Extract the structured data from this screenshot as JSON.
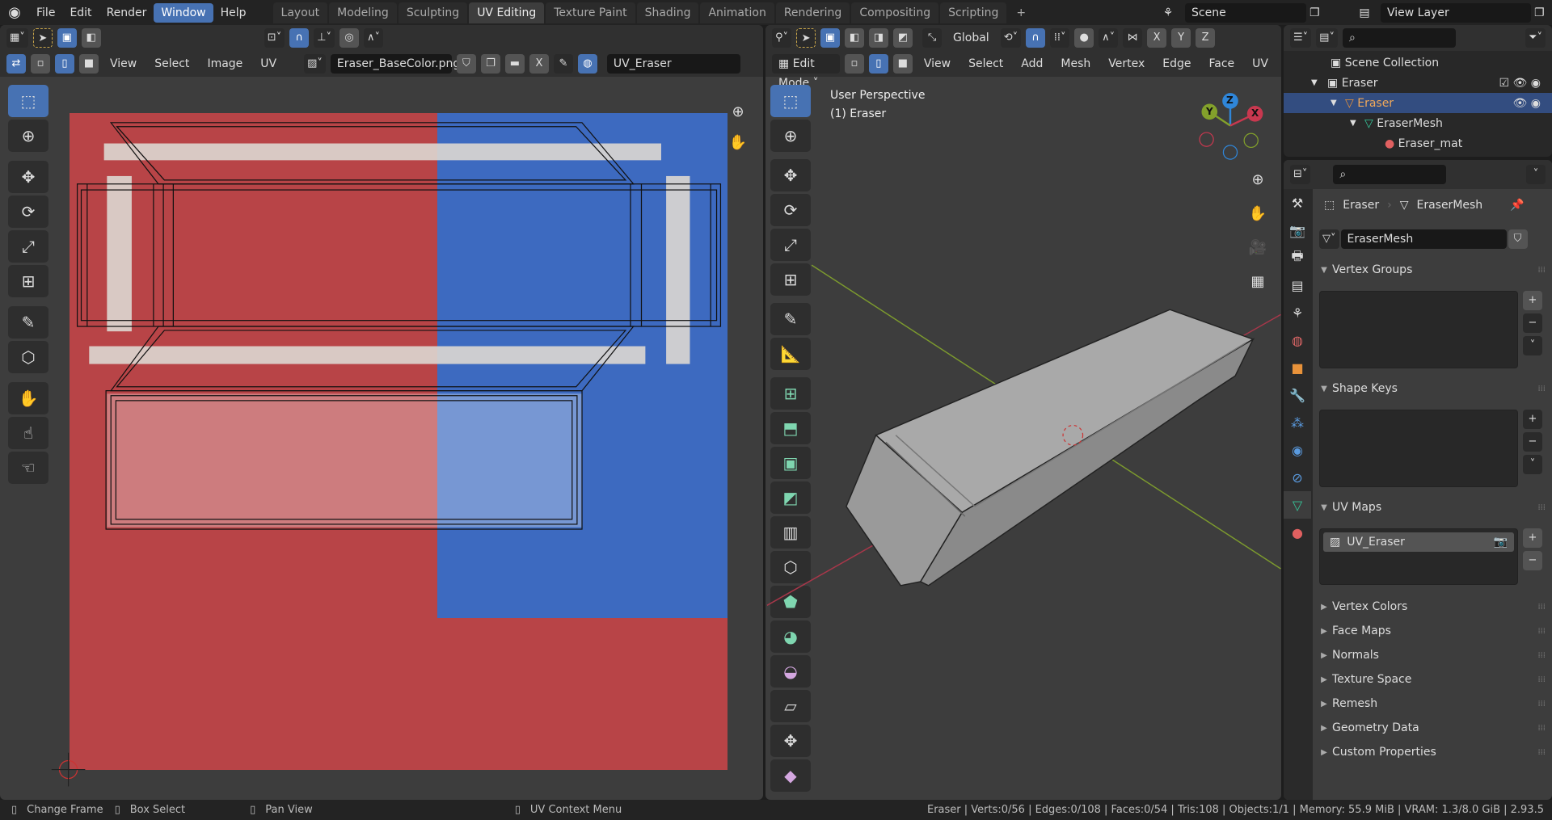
{
  "topbar": {
    "menus": [
      "File",
      "Edit",
      "Render",
      "Window",
      "Help"
    ],
    "active_menu": "Window",
    "workspaces": [
      "Layout",
      "Modeling",
      "Sculpting",
      "UV Editing",
      "Texture Paint",
      "Shading",
      "Animation",
      "Rendering",
      "Compositing",
      "Scripting"
    ],
    "active_workspace": "UV Editing",
    "add_tab": "+",
    "scene": "Scene",
    "view_layer": "View Layer"
  },
  "uv_editor": {
    "menus": [
      "View",
      "Select",
      "Image",
      "UV"
    ],
    "image_name": "Eraser_BaseColor.png",
    "uv_map": "UV_Eraser",
    "close": "X"
  },
  "viewport": {
    "mode": "Edit Mode",
    "menus": [
      "View",
      "Select",
      "Add",
      "Mesh",
      "Vertex",
      "Edge",
      "Face",
      "UV"
    ],
    "orientation": "Global",
    "axes": [
      "X",
      "Y",
      "Z"
    ],
    "overlay_title": "User Perspective",
    "overlay_object": "(1) Eraser",
    "gizmo": {
      "x": "X",
      "y": "Y",
      "z": "Z"
    }
  },
  "colors": {
    "accent": "#4772b3",
    "texture_red": "#b84447",
    "texture_blue": "#3d6ac0",
    "axis_x": "#c8384f",
    "axis_y": "#83a12b",
    "axis_z": "#2f86d9"
  },
  "outliner": {
    "root": "Scene Collection",
    "collection": "Eraser",
    "object": "Eraser",
    "mesh": "EraserMesh",
    "material": "Eraser_mat"
  },
  "properties": {
    "breadcrumb_object": "Eraser",
    "breadcrumb_mesh": "EraserMesh",
    "mesh_name": "EraserMesh",
    "sections": {
      "vertex_groups": "Vertex Groups",
      "shape_keys": "Shape Keys",
      "uv_maps": "UV Maps"
    },
    "uv_map_item": "UV_Eraser",
    "collapsed": [
      "Vertex Colors",
      "Face Maps",
      "Normals",
      "Texture Space",
      "Remesh",
      "Geometry Data",
      "Custom Properties"
    ]
  },
  "status": {
    "hints": [
      "Change Frame",
      "Box Select",
      "Pan View",
      "UV Context Menu"
    ],
    "stats": "Eraser | Verts:0/56 | Edges:0/108 | Faces:0/54 | Tris:108 | Objects:1/1 | Memory: 55.9 MiB | VRAM: 1.3/8.0 GiB | 2.93.5"
  }
}
